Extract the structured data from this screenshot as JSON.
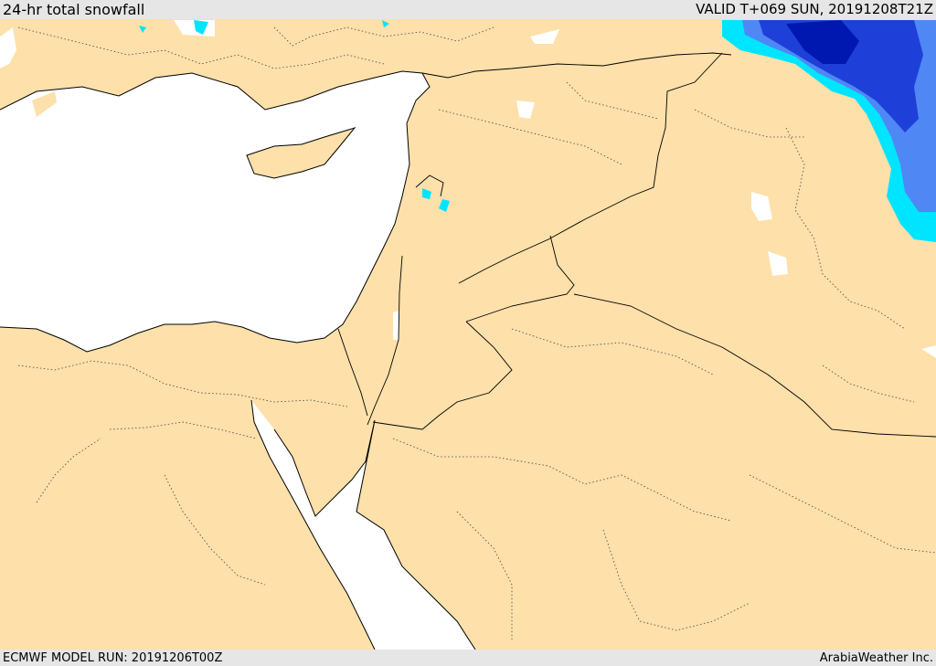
{
  "header": {
    "title": "24-hr total snowfall",
    "valid": "VALID T+069 SUN, 20191208T21Z"
  },
  "footer": {
    "model_run": "ECMWF MODEL RUN: 20191206T00Z",
    "credit": "ArabiaWeather Inc."
  },
  "map": {
    "land_color": "#fde0aa",
    "water_color": "#ffffff",
    "snow_colors": {
      "light": "#00e5ff",
      "medium": "#4f87f5",
      "heavy": "#1f3fd9",
      "very_heavy": "#0018b0"
    }
  }
}
